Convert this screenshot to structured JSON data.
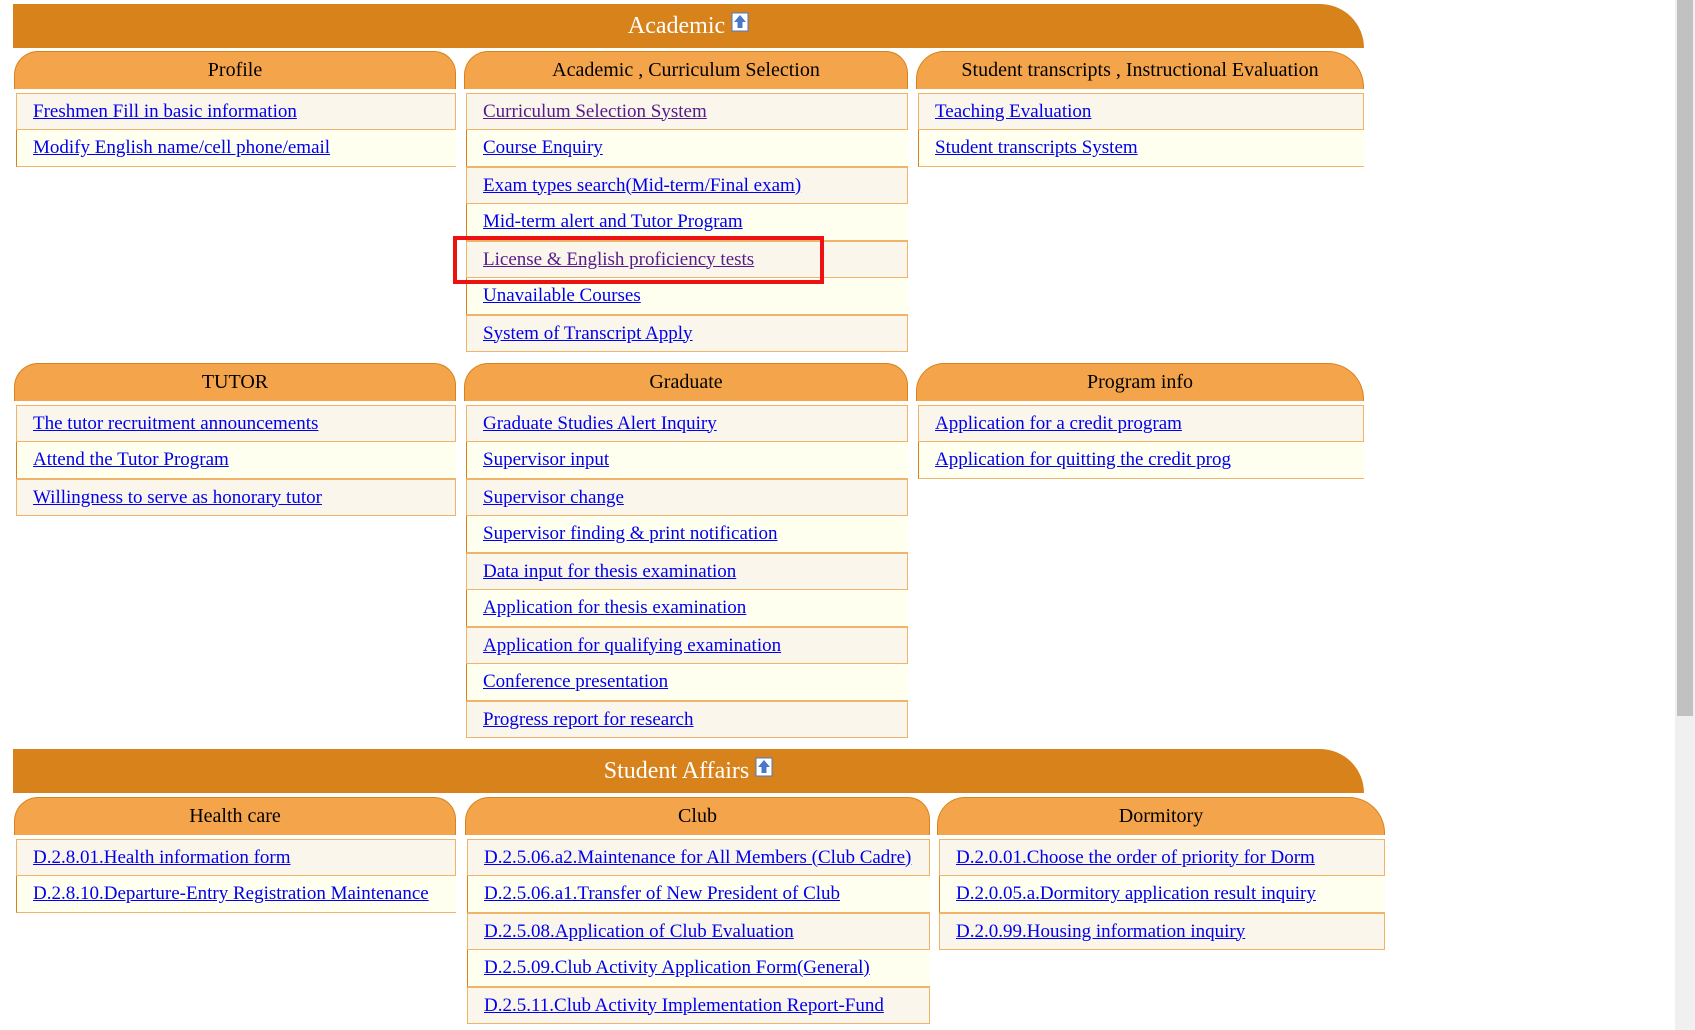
{
  "colors": {
    "banner": "#d8821c",
    "tab": "#f4a44b",
    "link": "#0000ee",
    "highlight": "#ee1111"
  },
  "academic": {
    "title": "Academic",
    "icon": "up-arrow-icon",
    "profile": {
      "title": "Profile",
      "items": [
        "Freshmen Fill in basic information",
        "Modify English name/cell phone/email"
      ]
    },
    "curriculum": {
      "title": "Academic , Curriculum Selection",
      "items": [
        "Curriculum Selection System",
        "Course Enquiry",
        "Exam types search(Mid-term/Final exam)",
        "Mid-term alert and Tutor Program",
        "License & English proficiency tests",
        "Unavailable Courses",
        "System of Transcript Apply"
      ]
    },
    "transcripts": {
      "title": "Student transcripts , Instructional Evaluation",
      "items": [
        "Teaching Evaluation",
        "Student transcripts System"
      ]
    },
    "tutor": {
      "title": "TUTOR",
      "items": [
        "The tutor recruitment announcements",
        "Attend the Tutor Program",
        "Willingness to serve as honorary tutor"
      ]
    },
    "graduate": {
      "title": "Graduate",
      "items": [
        "Graduate Studies Alert Inquiry",
        "Supervisor input",
        "Supervisor change",
        "Supervisor finding & print notification",
        "Data input for thesis examination",
        "Application for thesis examination",
        "Application for qualifying examination",
        "Conference presentation",
        "Progress report for research"
      ]
    },
    "program": {
      "title": "Program info",
      "items": [
        "Application for a credit program",
        "Application for quitting the credit prog"
      ]
    }
  },
  "student_affairs": {
    "title": "Student Affairs",
    "icon": "up-arrow-icon",
    "health": {
      "title": "Health care",
      "items": [
        "D.2.8.01.Health information form",
        "D.2.8.10.Departure-Entry Registration Maintenance"
      ]
    },
    "club": {
      "title": "Club",
      "items": [
        "D.2.5.06.a2.Maintenance for All Members (Club Cadre)",
        "D.2.5.06.a1.Transfer of New President of Club",
        "D.2.5.08.Application of Club Evaluation",
        "D.2.5.09.Club Activity Application Form(General)",
        "D.2.5.11.Club Activity Implementation Report-Fund"
      ]
    },
    "dormitory": {
      "title": "Dormitory",
      "items": [
        "D.2.0.01.Choose the order of priority for Dorm",
        "D.2.0.05.a.Dormitory application result inquiry",
        "D.2.0.99.Housing information inquiry"
      ]
    }
  }
}
